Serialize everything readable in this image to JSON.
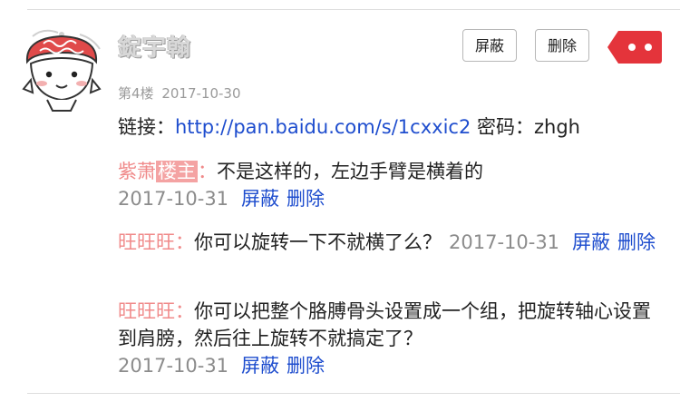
{
  "post": {
    "username": "錠宇翰",
    "floor": "第4楼",
    "date": "2017-10-30",
    "block_label": "屏蔽",
    "delete_label": "删除",
    "content_prefix": "链接：",
    "link": "http://pan.baidu.com/s/1cxxic2",
    "content_suffix": " 密码：zhgh"
  },
  "replies": [
    {
      "author": "紫萧",
      "badge": "楼主",
      "colon": "：",
      "text": "不是这样的，左边手臂是横着的",
      "time": "2017-10-31",
      "block_label": "屏蔽",
      "delete_label": "删除"
    },
    {
      "author": "旺旺旺",
      "colon": "：",
      "text": "你可以旋转一下不就横了么？",
      "time": "2017-10-31",
      "block_label": "屏蔽",
      "delete_label": "删除"
    },
    {
      "author": "旺旺旺",
      "colon": "：",
      "text": "你可以把整个胳膊骨头设置成一个组，把旋转轴心设置到肩膀，然后往上旋转不就搞定了？",
      "time": "2017-10-31",
      "block_label": "屏蔽",
      "delete_label": "删除"
    }
  ],
  "colors": {
    "accent_red": "#e4343b",
    "link_blue": "#1e4dce",
    "author_pink": "#f08a8a",
    "badge_pink": "#f4a3a3",
    "meta_gray": "#9a9a9a"
  },
  "icons": {
    "more": "more-dots-icon",
    "avatar": "cartoon-avatar"
  }
}
